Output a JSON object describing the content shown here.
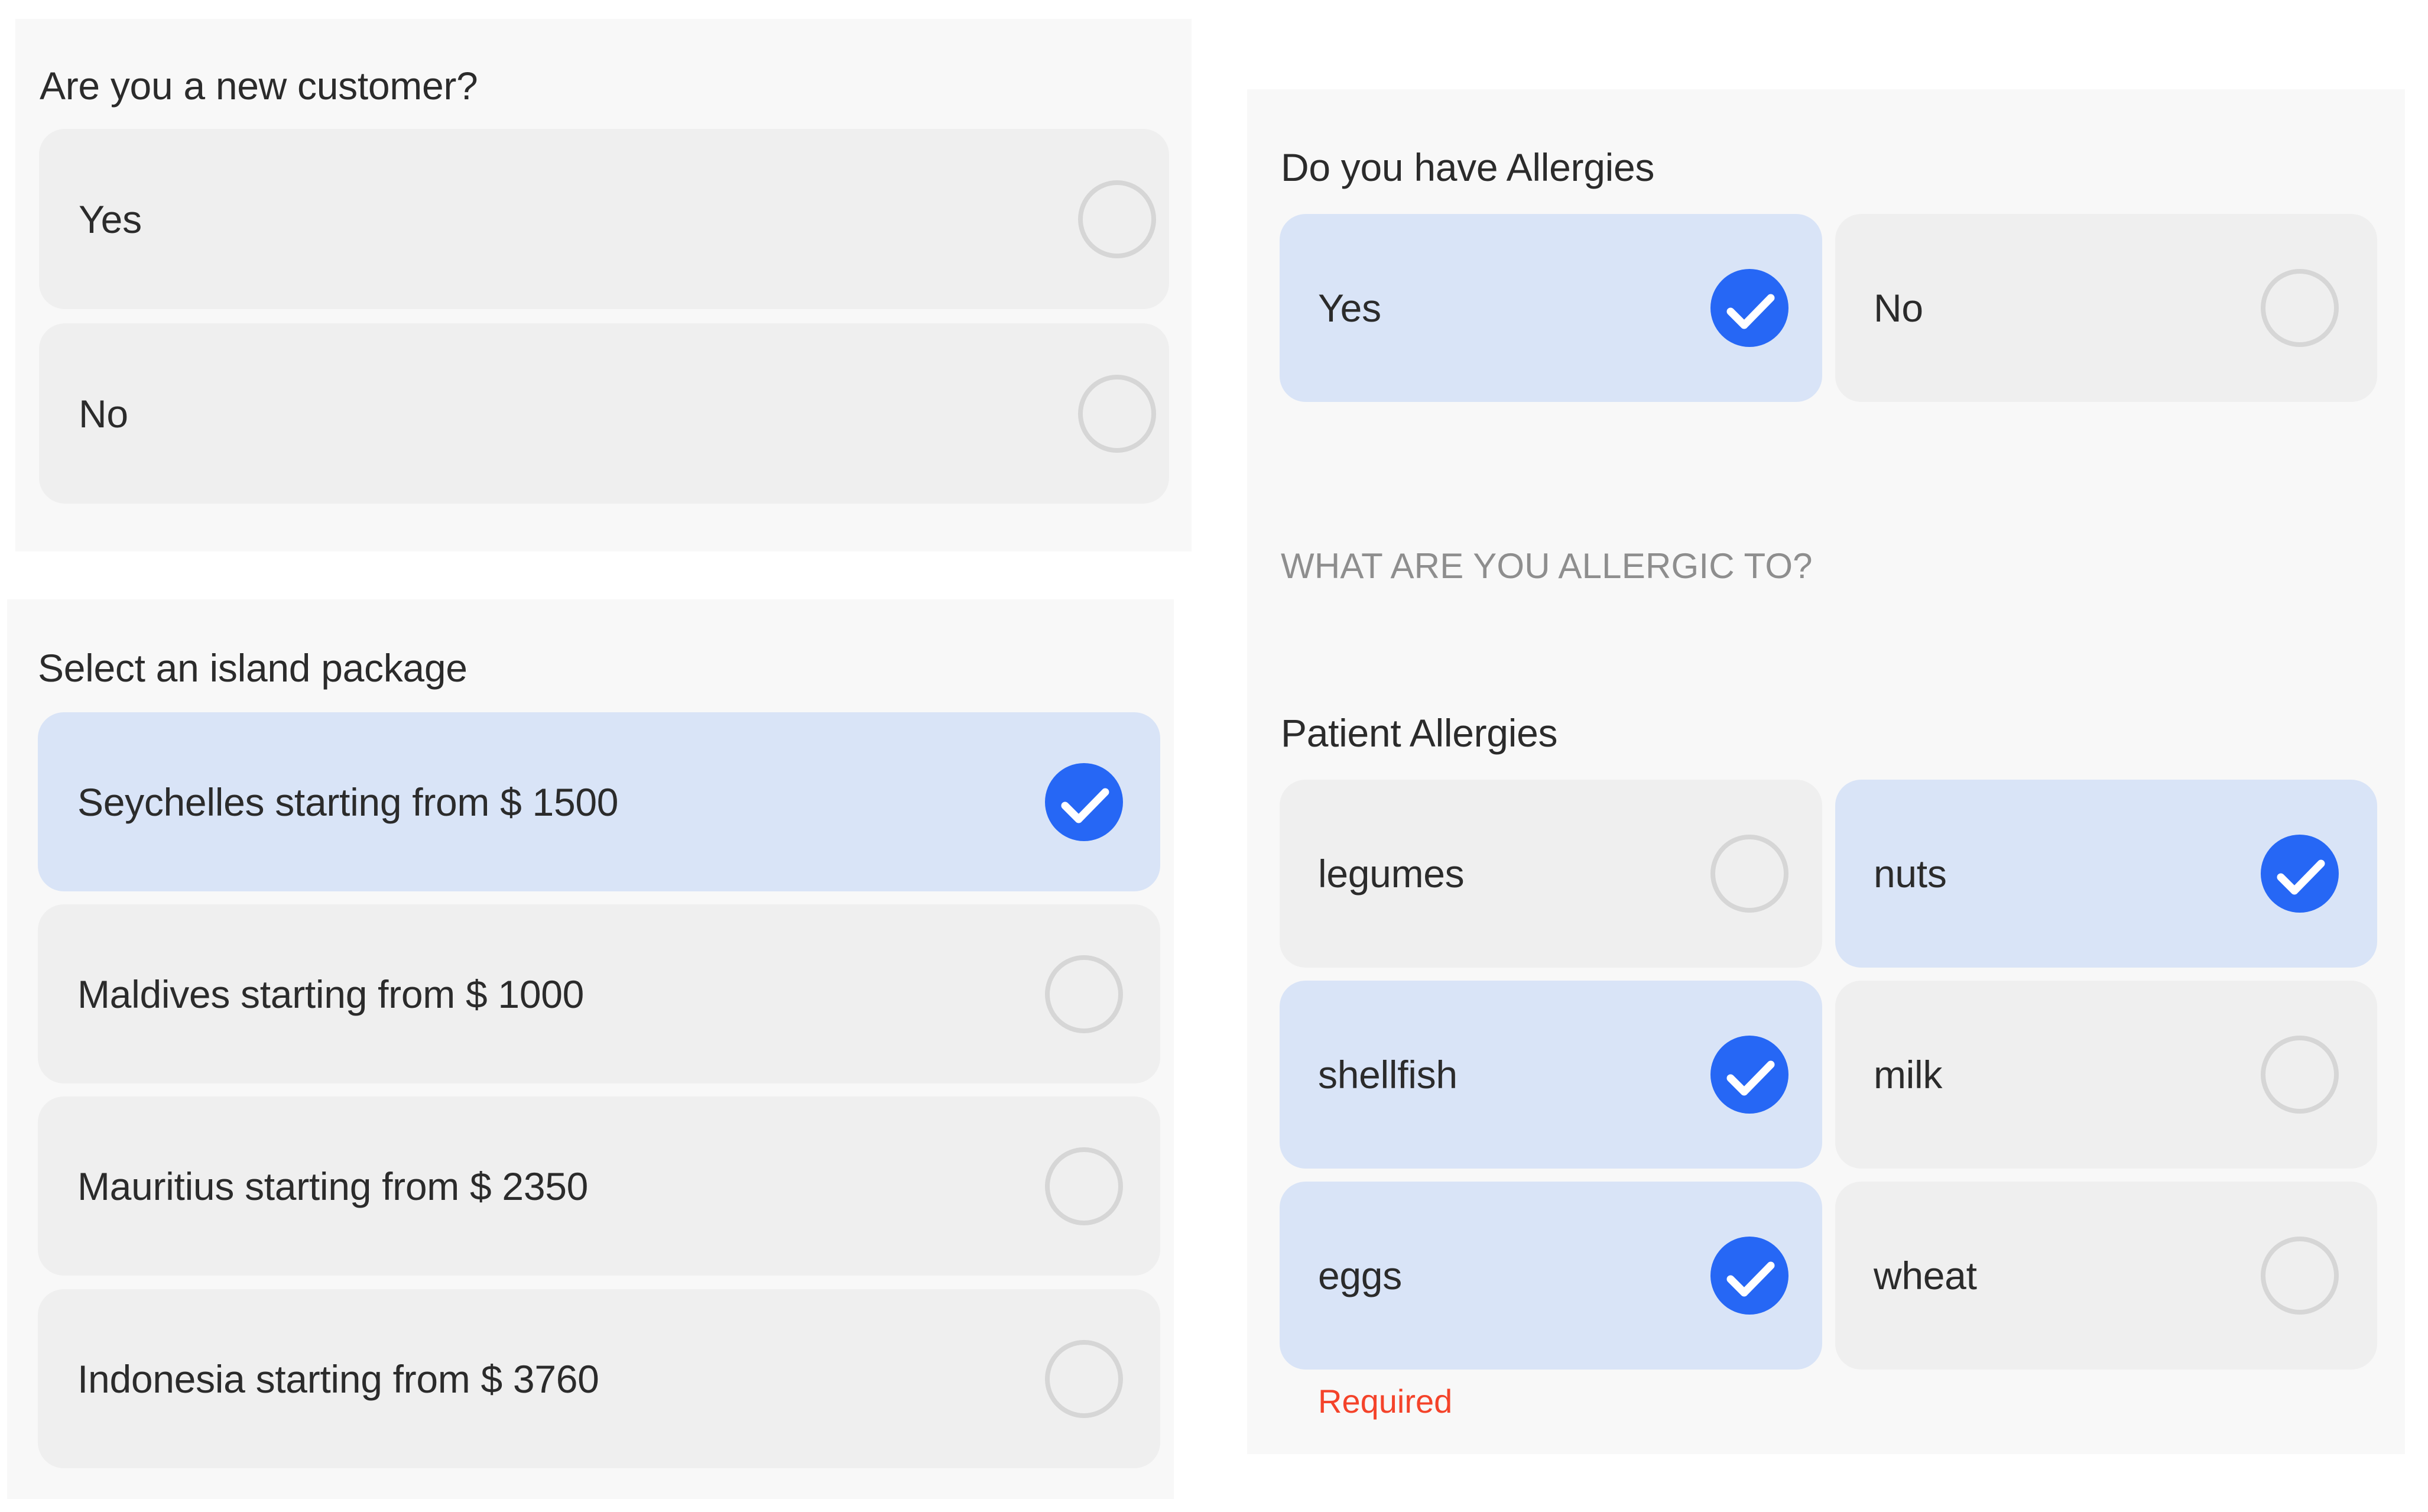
{
  "new_customer": {
    "question": "Are you a new customer?",
    "options": [
      {
        "label": "Yes",
        "selected": false
      },
      {
        "label": "No",
        "selected": false
      }
    ]
  },
  "island_package": {
    "question": "Select an island package",
    "options": [
      {
        "label": "Seychelles starting from $ 1500",
        "selected": true
      },
      {
        "label": "Maldives starting from $ 1000",
        "selected": false
      },
      {
        "label": "Mauritius starting from $ 2350",
        "selected": false
      },
      {
        "label": "Indonesia starting from $ 3760",
        "selected": false
      }
    ]
  },
  "allergies": {
    "question": "Do you have Allergies",
    "options": [
      {
        "label": "Yes",
        "selected": true
      },
      {
        "label": "No",
        "selected": false
      }
    ],
    "section_label": "WHAT ARE YOU ALLERGIC TO?",
    "list_title": "Patient Allergies",
    "items": [
      {
        "label": "legumes",
        "selected": false
      },
      {
        "label": "nuts",
        "selected": true
      },
      {
        "label": "shellfish",
        "selected": true
      },
      {
        "label": "milk",
        "selected": false
      },
      {
        "label": "eggs",
        "selected": true
      },
      {
        "label": "wheat",
        "selected": false
      }
    ],
    "error": "Required"
  },
  "colors": {
    "accent": "#2667f5",
    "selected_card": "#d9e4f7",
    "unselected_card": "#efefef",
    "panel": "#f8f8f8",
    "error": "#f4432a",
    "overline": "#8e8e8e"
  },
  "icons": {
    "selected": "check-circle-icon",
    "unselected": "radio-empty-icon"
  }
}
